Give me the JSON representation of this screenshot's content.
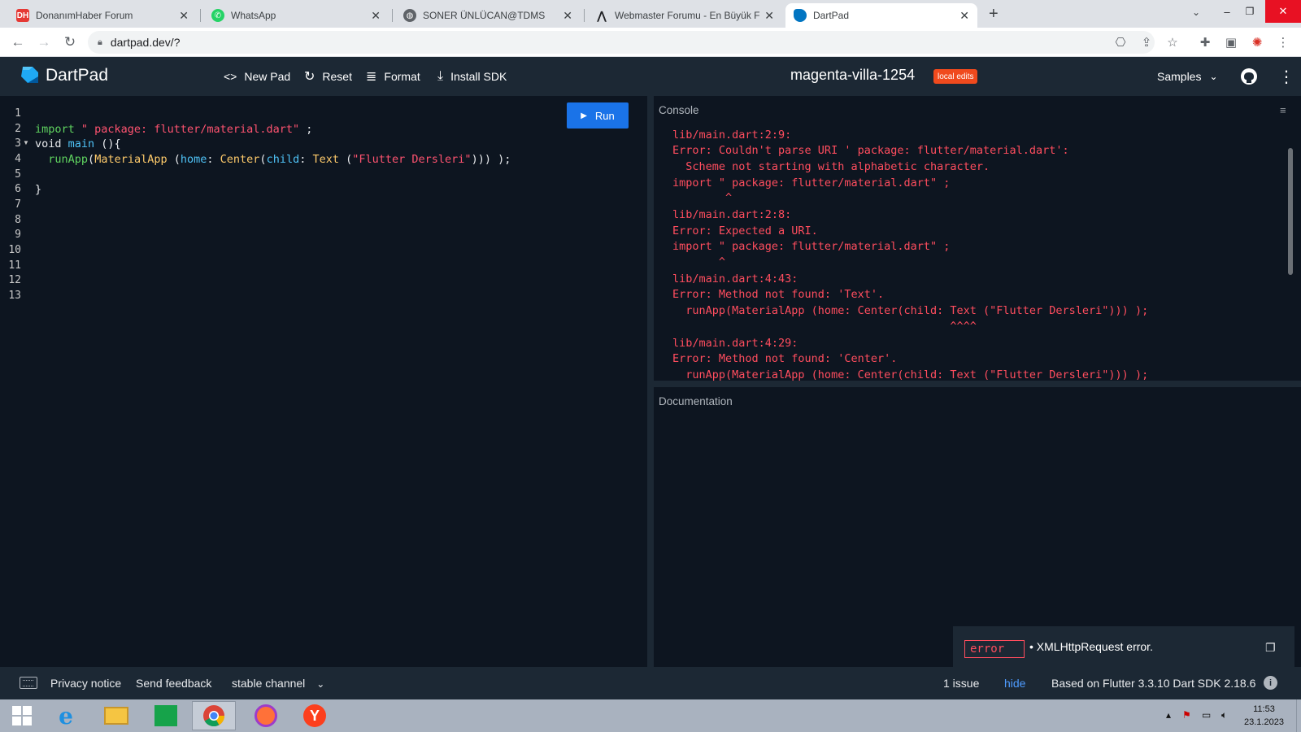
{
  "browser": {
    "tabs": [
      {
        "title": "DonanımHaber Forum",
        "icon": "donanimhaber-icon",
        "color": "#e53935"
      },
      {
        "title": "WhatsApp",
        "icon": "whatsapp-icon",
        "color": "#25d366"
      },
      {
        "title": "SONER ÜNLÜCAN@TDMS",
        "icon": "globe-icon",
        "color": "#5f6368"
      },
      {
        "title": "Webmaster Forumu - En Büyük F",
        "icon": "webmaster-icon",
        "color": "#202124"
      },
      {
        "title": "DartPad",
        "icon": "dartpad-icon",
        "color": "#0175c2"
      }
    ],
    "active_tab": 4,
    "url": "dartpad.dev/?"
  },
  "header": {
    "logo_text": "DartPad",
    "new_pad": "New Pad",
    "reset": "Reset",
    "format": "Format",
    "install_sdk": "Install SDK",
    "pad_name": "magenta-villa-1254",
    "badge": "local edits",
    "samples": "Samples"
  },
  "editor": {
    "run_label": "Run",
    "line_numbers": [
      "1",
      "2",
      "3",
      "4",
      "5",
      "6",
      "7",
      "8",
      "9",
      "10",
      "11",
      "12",
      "13"
    ],
    "line2": {
      "kw": "import",
      "str": " \" package: flutter/material.dart\" ",
      "rest": ";"
    },
    "line3": {
      "kw": "void",
      "fn": "main",
      "rest": " (){"
    },
    "line4": {
      "fn": "runApp",
      "p1": "(",
      "cls1": "MaterialApp",
      "p2": " (",
      "prm1": "home",
      "c1": ": ",
      "cls2": "Center",
      "p3": "(",
      "prm2": "child",
      "c2": ": ",
      "cls3": "Text",
      "p4": " (",
      "str": "\"Flutter Dersleri\"",
      "p5": "))) );"
    },
    "line6": "}"
  },
  "console": {
    "label": "Console",
    "lines": [
      "lib/main.dart:2:9:",
      "Error: Couldn't parse URI ' package: flutter/material.dart':",
      "  Scheme not starting with alphabetic character.",
      "import \" package: flutter/material.dart\" ;",
      "        ^",
      "lib/main.dart:2:8:",
      "Error: Expected a URI.",
      "import \" package: flutter/material.dart\" ;",
      "       ^",
      "lib/main.dart:4:43:",
      "Error: Method not found: 'Text'.",
      "  runApp(MaterialApp (home: Center(child: Text (\"Flutter Dersleri\"))) );",
      "                                          ^^^^",
      "lib/main.dart:4:29:",
      "Error: Method not found: 'Center'.",
      "  runApp(MaterialApp (home: Center(child: Text (\"Flutter Dersleri\"))) );"
    ]
  },
  "documentation": {
    "label": "Documentation",
    "issue_kind": "error",
    "issue_message": "• XMLHttpRequest error."
  },
  "footer": {
    "privacy": "Privacy notice",
    "feedback": "Send feedback",
    "channel": "stable channel",
    "issues": "1 issue",
    "hide": "hide",
    "version": "Based on Flutter 3.3.10 Dart SDK 2.18.6"
  },
  "taskbar": {
    "time": "11:53",
    "date": "23.1.2023"
  },
  "colors": {
    "editor_bg": "#0d1520",
    "panel_bg": "#1c2834",
    "run_blue": "#1a73e8",
    "error_red": "#ff4d5e",
    "badge_orange": "#f04a1d"
  }
}
